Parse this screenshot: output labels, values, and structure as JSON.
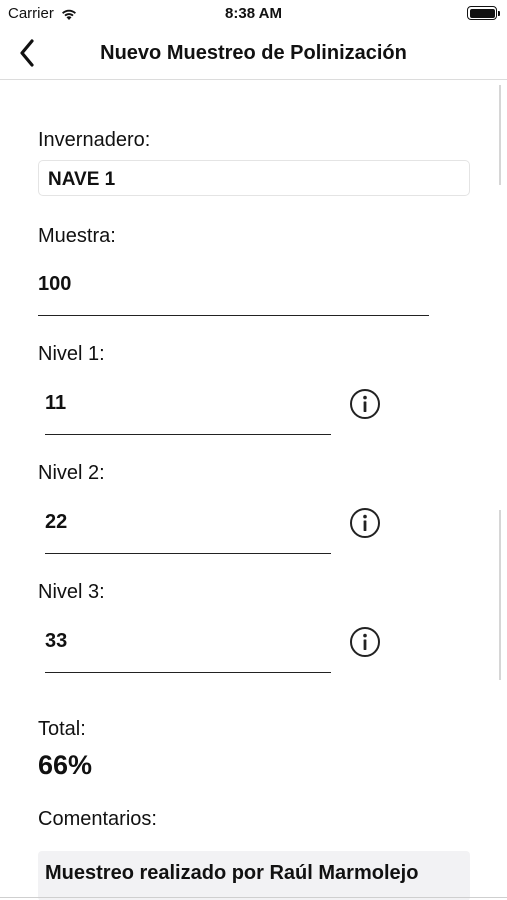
{
  "status_bar": {
    "carrier": "Carrier",
    "time": "8:38 AM",
    "wifi_icon": "wifi-icon",
    "battery_icon": "battery-icon"
  },
  "nav": {
    "back_icon": "chevron-left-icon",
    "title": "Nuevo Muestreo de Polinización"
  },
  "form": {
    "invernadero": {
      "label": "Invernadero:",
      "value": "NAVE 1"
    },
    "muestra": {
      "label": "Muestra:",
      "value": "100"
    },
    "nivel1": {
      "label": "Nivel 1:",
      "value": "11",
      "info_icon": "info-icon"
    },
    "nivel2": {
      "label": "Nivel 2:",
      "value": "22",
      "info_icon": "info-icon"
    },
    "nivel3": {
      "label": "Nivel 3:",
      "value": "33",
      "info_icon": "info-icon"
    },
    "total": {
      "label": "Total:",
      "value": "66%"
    },
    "comentarios": {
      "label": "Comentarios:",
      "value": "Muestreo realizado por Raúl Marmolejo"
    }
  }
}
